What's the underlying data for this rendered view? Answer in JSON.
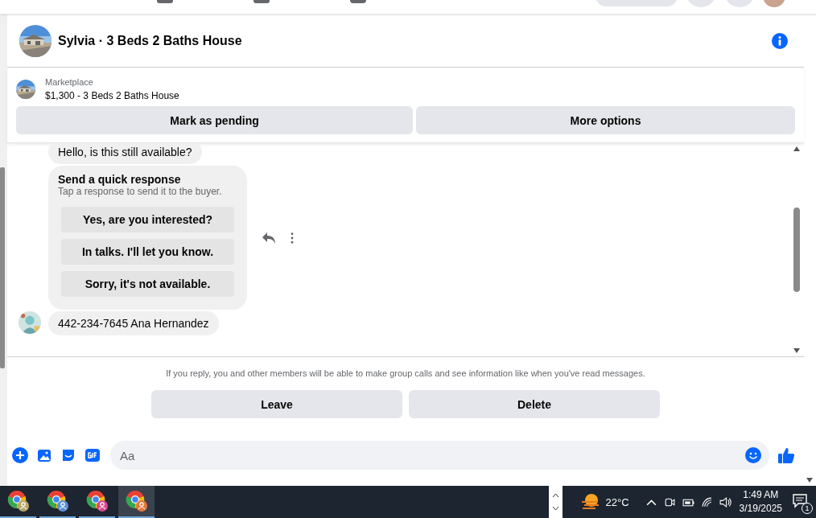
{
  "header": {
    "title": "Sylvia · 3 Beds 2 Baths House"
  },
  "listing": {
    "source": "Marketplace",
    "title": "$1,300 - 3 Beds 2 Baths House",
    "actions": [
      "Mark as pending",
      "More options"
    ]
  },
  "messages": [
    {
      "kind": "text",
      "text": "Hello, is this still available?",
      "show_avatar": false
    },
    {
      "kind": "quick_response",
      "title": "Send a quick response",
      "subtitle": "Tap a response to send it to the buyer.",
      "options": [
        "Yes, are you interested?",
        "In talks. I'll let you know.",
        "Sorry, it's not available."
      ],
      "show_avatar": false
    },
    {
      "kind": "text",
      "text": "442-234-7645 Ana Hernandez",
      "show_avatar": true
    }
  ],
  "notice": {
    "text": "If you reply, you and other members will be able to make group calls and see information like when you've read messages.",
    "buttons": [
      "Leave",
      "Delete"
    ]
  },
  "composer": {
    "placeholder": "Aa"
  },
  "taskbar": {
    "apps": [
      {
        "selected": false,
        "color": "#b5a76a"
      },
      {
        "selected": false,
        "color": "#5b8fd6"
      },
      {
        "selected": false,
        "color": "#d6488f"
      },
      {
        "selected": true,
        "color": "#e8763a"
      }
    ],
    "temperature": "22°C",
    "time": "1:49 AM",
    "date": "3/19/2025",
    "notifications": "1"
  }
}
